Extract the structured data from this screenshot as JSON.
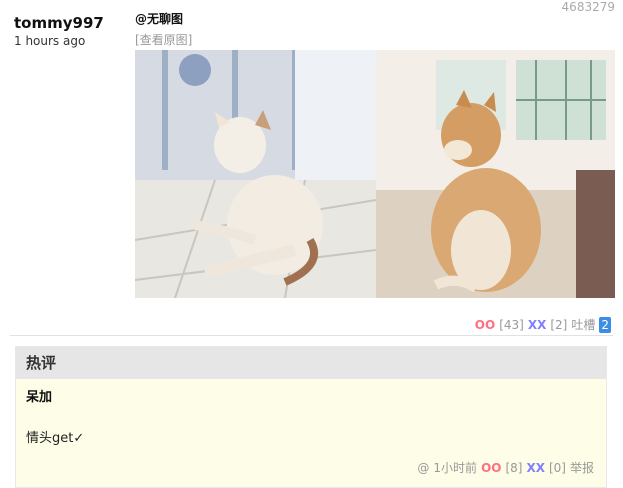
{
  "post": {
    "id": "4683279",
    "author": "tommy997",
    "time": "1 hours ago",
    "title": "@无聊图",
    "view_original": "[查看原图]",
    "oo_label": "OO",
    "oo_count": "[43]",
    "xx_label": "XX",
    "xx_count": "[2]",
    "tucao_label": "吐槽",
    "tucao_count": "2"
  },
  "hot": {
    "title": "热评",
    "comment": {
      "author": "呆加",
      "text": "情头get✓",
      "at": "@",
      "time": "1小时前",
      "oo_label": "OO",
      "oo_count": "[8]",
      "xx_label": "XX",
      "xx_count": "[0]",
      "report": "举报"
    }
  },
  "colors": {
    "oo": "#ff6f7f",
    "xx": "#7f7fff",
    "tucao_badge": "#3a8ee6",
    "hot_bg": "#fdfde8"
  }
}
